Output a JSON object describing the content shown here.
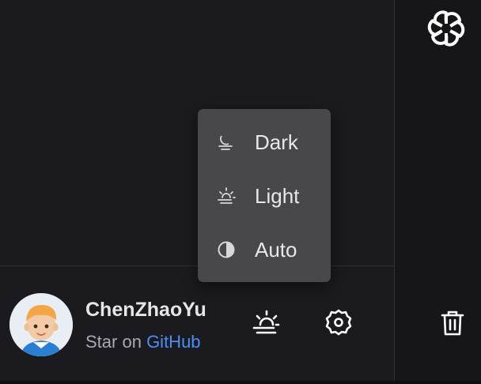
{
  "theme_menu": {
    "items": [
      {
        "label": "Dark",
        "icon": "moon-haze-icon"
      },
      {
        "label": "Light",
        "icon": "sun-haze-icon"
      },
      {
        "label": "Auto",
        "icon": "half-circle-icon"
      }
    ]
  },
  "user": {
    "name": "ChenZhaoYu",
    "star_prefix": "Star on",
    "star_link": "GitHub"
  },
  "toolbar": {
    "theme_icon": "sun-haze-icon",
    "settings_icon": "gear-icon",
    "delete_icon": "trash-icon"
  },
  "brand": {
    "logo_icon": "openai-logo-icon"
  },
  "colors": {
    "background": "#1b1b1f",
    "menu_background": "#47474c",
    "link": "#4b8ef7"
  }
}
